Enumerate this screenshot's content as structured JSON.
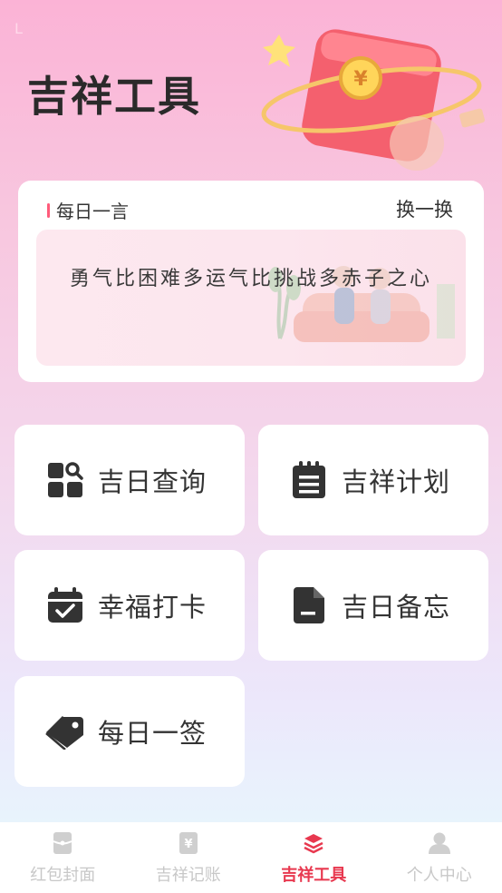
{
  "status_bar": {
    "mark": "L"
  },
  "page_title": "吉祥工具",
  "quote": {
    "header": "每日一言",
    "refresh_label": "换一换",
    "text": "勇气比困难多运气比挑战多赤子之心"
  },
  "tools": [
    {
      "label": "吉日查询",
      "icon": "grid-search-icon"
    },
    {
      "label": "吉祥计划",
      "icon": "notepad-icon"
    },
    {
      "label": "幸福打卡",
      "icon": "calendar-check-icon"
    },
    {
      "label": "吉日备忘",
      "icon": "document-icon"
    },
    {
      "label": "每日一签",
      "icon": "tag-icon"
    }
  ],
  "tabs": [
    {
      "label": "红包封面",
      "icon": "envelope-icon",
      "active": false
    },
    {
      "label": "吉祥记账",
      "icon": "yen-ledger-icon",
      "active": false
    },
    {
      "label": "吉祥工具",
      "icon": "layers-icon",
      "active": true
    },
    {
      "label": "个人中心",
      "icon": "person-icon",
      "active": false
    }
  ],
  "colors": {
    "accent": "#e8384f",
    "icon": "#333333",
    "tab_inactive": "#c8c8c8"
  }
}
